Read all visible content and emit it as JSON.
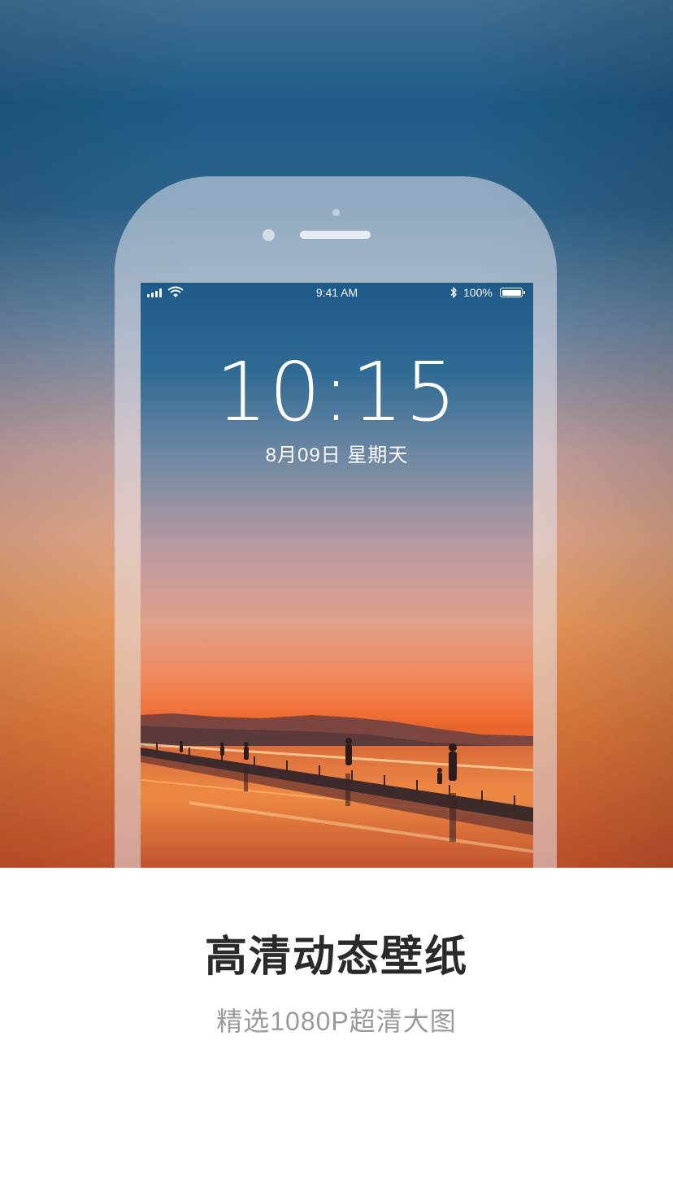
{
  "phone_screen": {
    "status_bar": {
      "time": "9:41 AM",
      "bluetooth_icon": "bluetooth-icon",
      "battery_percent": "100%",
      "signal_icon": "signal-bars-icon",
      "wifi_icon": "wifi-icon",
      "battery_icon": "battery-full-icon"
    },
    "lock_clock": "10:15",
    "lock_date": "8月09日  星期天"
  },
  "promo": {
    "title": "高清动态壁纸",
    "subtitle": "精选1080P超清大图"
  },
  "colors": {
    "title": "#2a2a2a",
    "subtitle": "#9a9a9a",
    "background_bottom": "#ffffff",
    "sky_top": "#1f5b86",
    "sunset_orange": "#ef6e34"
  }
}
